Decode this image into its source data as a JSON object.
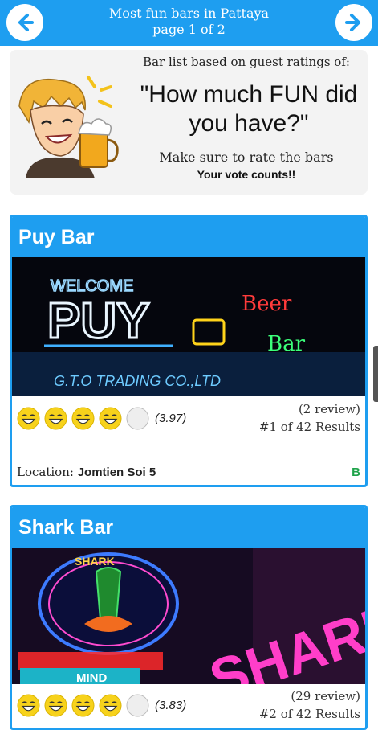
{
  "header": {
    "title_line1": "Most fun bars in Pattaya",
    "title_line2": "page 1 of 2",
    "back_icon": "arrow-left-icon",
    "forward_icon": "arrow-right-icon"
  },
  "promo": {
    "line1": "Bar list based on guest ratings of:",
    "quote": "\"How much FUN did you have?\"",
    "line3": "Make sure to rate the bars",
    "line4": "Your vote counts!!"
  },
  "bars": [
    {
      "name": "Puy Bar",
      "sign_text": "WELCOME",
      "sign_brand": "PUY",
      "sign_beer": "Beer",
      "sign_bar": "Bar",
      "sign_footer": "G.T.O TRADING CO.,LTD",
      "rating_faces_filled": 4,
      "rating_faces_total": 5,
      "score": "(3.97)",
      "reviews": "(2 review)",
      "rank": "#1 of 42 Results",
      "location_label": "Location:",
      "location_value": "Jomtien Soi 5",
      "price": "B"
    },
    {
      "name": "Shark Bar",
      "sign_text": "SHARK",
      "sign_mind": "MIND",
      "rating_faces_filled": 4,
      "rating_faces_total": 5,
      "score": "(3.83)",
      "reviews": "(29 review)",
      "rank": "#2 of 42 Results"
    }
  ],
  "colors": {
    "accent": "#1e9ef0",
    "face_yellow": "#f7d21b",
    "price_green": "#1ea34a"
  }
}
